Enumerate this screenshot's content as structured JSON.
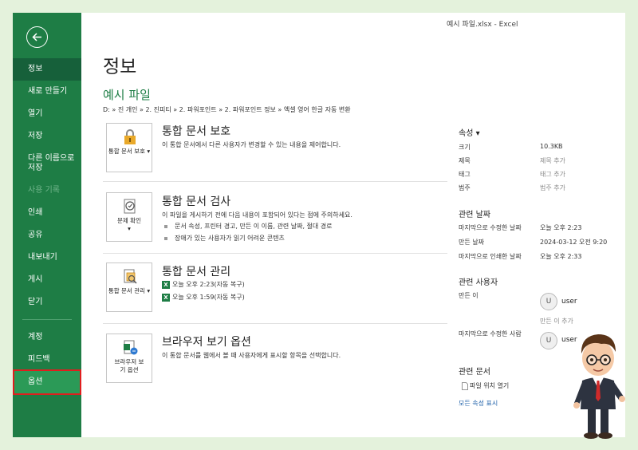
{
  "window_title": "예시 파일.xlsx  -  Excel",
  "sidebar": {
    "items": [
      {
        "label": "정보"
      },
      {
        "label": "새로 만들기"
      },
      {
        "label": "열기"
      },
      {
        "label": "저장"
      },
      {
        "label": "다른 이름으로 저장"
      },
      {
        "label": "사용 기록"
      },
      {
        "label": "인쇄"
      },
      {
        "label": "공유"
      },
      {
        "label": "내보내기"
      },
      {
        "label": "게시"
      },
      {
        "label": "닫기"
      },
      {
        "label": "계정"
      },
      {
        "label": "피드백"
      },
      {
        "label": "옵션"
      }
    ]
  },
  "page": {
    "title": "정보",
    "file_name": "예시 파일",
    "path": "D: » 진 개인 » 2. 진피티 » 2. 파워포인트 » 2. 파워포인트 정보 » 엑셀 영어 한글 자동 변환"
  },
  "sections": {
    "protect": {
      "tile": "통합 문서 보호 ▾",
      "title": "통합 문서 보호",
      "desc": "이 통합 문서에서 다른 사용자가 변경할 수 있는 내용을 제어합니다."
    },
    "inspect": {
      "tile": "문제 확인 ▾",
      "title": "통합 문서 검사",
      "desc": "이 파일을 게시하기 전에 다음 내용이 포함되어 있다는 점에 주의하세요.",
      "bullets": [
        "문서 속성, 프린터 경고, 만든 이 이름, 관련 날짜, 절대 경로",
        "장애가 있는 사용자가 읽기 어려운 콘텐츠"
      ]
    },
    "manage": {
      "tile": "통합 문서 관리 ▾",
      "title": "통합 문서 관리",
      "versions": [
        "오늘 오후 2:23(자동 복구)",
        "오늘 오후 1:59(자동 복구)"
      ]
    },
    "browser": {
      "tile": "브라우저 보기 옵션",
      "title": "브라우저 보기 옵션",
      "desc": "이 통합 문서를 웹에서 볼 때 사용자에게 표시할 항목을 선택합니다."
    }
  },
  "properties": {
    "header": "속성 ▾",
    "size_label": "크기",
    "size_value": "10.3KB",
    "title_label": "제목",
    "title_value": "제목 추가",
    "tags_label": "태그",
    "tags_value": "태그 추가",
    "category_label": "범주",
    "category_value": "범주 추가"
  },
  "dates": {
    "header": "관련 날짜",
    "modified_label": "마지막으로 수정한 날짜",
    "modified_value": "오늘 오후 2:23",
    "created_label": "만든 날짜",
    "created_value": "2024-03-12 오전 9:20",
    "printed_label": "마지막으로 인쇄한 날짜",
    "printed_value": "오늘 오후 2:33"
  },
  "people": {
    "header": "관련 사용자",
    "author_label": "만든 이",
    "author_initial": "U",
    "author_name": "user",
    "add_author": "만든 이 추가",
    "modifier_label": "마지막으로 수정한 사람",
    "modifier_initial": "U",
    "modifier_name": "user"
  },
  "documents": {
    "header": "관련 문서",
    "open_location": "파일 위치 열기",
    "show_all": "모든 속성 표시"
  }
}
